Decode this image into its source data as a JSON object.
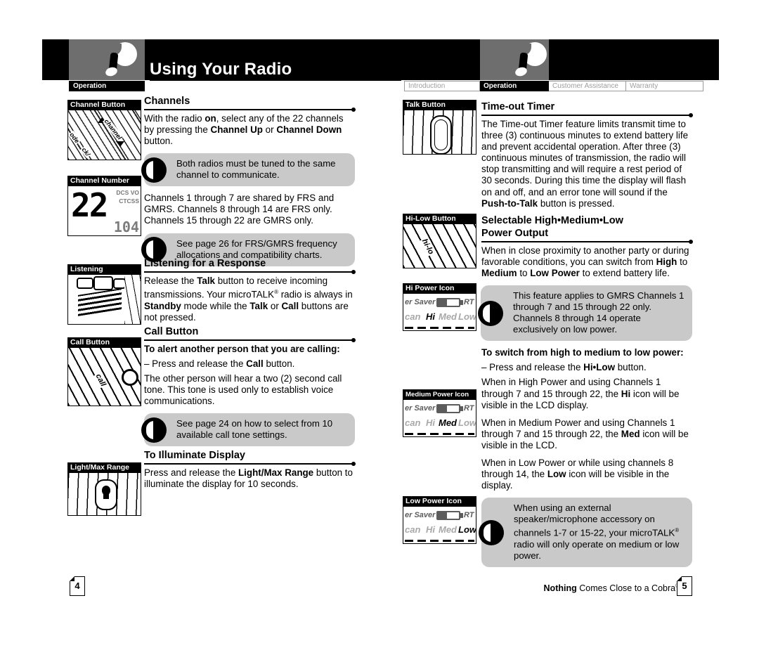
{
  "header": {
    "title": "Using Your Radio",
    "logo_icon": "cobra-radio-person-logo",
    "left_tabs": [
      {
        "label": "Operation",
        "active": true
      }
    ],
    "right_tabs": [
      {
        "label": "Introduction",
        "active": false
      },
      {
        "label": "Operation",
        "active": true
      },
      {
        "label": "Customer Assistance",
        "active": false
      },
      {
        "label": "Warranty",
        "active": false
      }
    ]
  },
  "left_page": {
    "thumbs": {
      "channel_button": {
        "caption": "Channel Button",
        "labels": {
          "mode": "ode",
          "channel": "channel",
          "lock": "ck/"
        }
      },
      "channel_number": {
        "caption": "Channel Number",
        "value": "22",
        "tag1": "DCS VO",
        "tag2": "CTCSS",
        "sub": "104"
      },
      "listening": {
        "caption": "Listening"
      },
      "call_button": {
        "caption": "Call Button",
        "label": "call"
      },
      "light_max_range": {
        "caption": "Light/Max Range",
        "icon": "light-bulb-icon"
      }
    },
    "sections": [
      {
        "id": "channels",
        "heading": "Channels",
        "p1_a": "With the radio ",
        "p1_b": "on",
        "p1_c": ", select any of the 22 channels by pressing the ",
        "p1_d": "Channel Up",
        "p1_e": " or ",
        "p1_f": "Channel Down",
        "p1_g": " button.",
        "note1": "Both radios must be tuned to the same channel to communicate.",
        "p2": "Channels 1 through 7 are shared by FRS and GMRS. Channels 8 through 14 are FRS only. Channels 15 through 22 are GMRS only.",
        "note2": "See page 26 for FRS/GMRS frequency allocations and compatibility charts."
      },
      {
        "id": "listening",
        "heading": "Listening for a Response",
        "p1_a": "Release the ",
        "p1_b": "Talk",
        "p1_c": " button to receive incoming transmissions. Your microTALK",
        "p1_sup": "®",
        "p1_d": " radio is always in ",
        "p1_e": "Standby",
        "p1_f": " mode while the ",
        "p1_g": "Talk",
        "p1_h": " or ",
        "p1_i": "Call",
        "p1_j": " buttons are not pressed."
      },
      {
        "id": "call-button",
        "heading": "Call Button",
        "subhead": "To alert another person that you are calling:",
        "bullet_a": "– Press and release the ",
        "bullet_b": "Call",
        "bullet_c": " button.",
        "p1": "The other person will hear a two (2) second call tone. This tone is used only to establish voice communications.",
        "note1": "See page 24 on how to select from 10 available call tone settings."
      },
      {
        "id": "illuminate",
        "heading": "To Illuminate Display",
        "p1_a": "Press and release the ",
        "p1_b": "Light/Max Range",
        "p1_c": " button to illuminate the display for 10 seconds."
      }
    ]
  },
  "right_page": {
    "thumbs": {
      "talk_button": {
        "caption": "Talk Button"
      },
      "hi_low_button": {
        "caption": "Hi-Low Button",
        "label": "hi-lo"
      },
      "hi_power": {
        "caption": "Hi Power Icon",
        "saver": "er Saver",
        "rt": "RT",
        "scan": "can",
        "o1": "Hi",
        "o2": "Med",
        "o3": "Low",
        "active": "Hi"
      },
      "medium_power": {
        "caption": "Medium Power Icon",
        "saver": "er Saver",
        "rt": "RT",
        "scan": "can",
        "o1": "Hi",
        "o2": "Med",
        "o3": "Low",
        "active": "Med"
      },
      "low_power": {
        "caption": "Low Power Icon",
        "saver": "er Saver",
        "rt": "RT",
        "scan": "can",
        "o1": "Hi",
        "o2": "Med",
        "o3": "Low",
        "active": "Low"
      }
    },
    "sections": [
      {
        "id": "time-out-timer",
        "heading": "Time-out Timer",
        "p1_a": "The Time-out Timer feature limits transmit time to three (3) continuous minutes to extend battery life and prevent accidental operation. After three (3) continuous minutes of transmission, the radio will stop transmitting and will require a rest period of 30 seconds. During this time the display will flash on and off, and an error tone will sound if the ",
        "p1_b": "Push-to-Talk",
        "p1_c": " button is pressed."
      },
      {
        "id": "power-output",
        "heading_l1": "Selectable High•Medium•Low",
        "heading_l2": "Power Output",
        "p1_a": "When in close proximity to another party or during favorable conditions, you can switch from ",
        "p1_b": "High",
        "p1_c": " to ",
        "p1_d": "Medium",
        "p1_e": " to ",
        "p1_f": "Low Power",
        "p1_g": " to extend battery life.",
        "note1": "This feature applies to GMRS Channels 1 through 7 and 15 through 22 only. Channels 8 through 14 operate exclusively on low power.",
        "subhead": "To switch from high to medium to low power:",
        "bullet_a": "– Press and release the ",
        "bullet_b": "Hi•Low",
        "bullet_c": " button.",
        "p2_a": "When in High Power and using Channels 1 through 7 and 15 through 22, the ",
        "p2_b": "Hi",
        "p2_c": " icon will be visible in the LCD display.",
        "p3_a": "When in Medium Power and using Channels 1 through 7 and 15 through 22, the ",
        "p3_b": "Med",
        "p3_c": " icon will be visible in the LCD.",
        "p4_a": "When in Low Power or while using channels 8 through 14, the ",
        "p4_b": "Low",
        "p4_c": " icon will be visible in the display.",
        "note2_a": "When using an external speaker/microphone accessory on channels 1-7 or 15-22, your microTALK",
        "note2_sup": "®",
        "note2_b": " radio will only operate on medium or low power."
      }
    ]
  },
  "footer": {
    "tagline_bold": "Nothing",
    "tagline_rest": " Comes Close to a Cobra",
    "tagline_sup": "®",
    "page_left": "4",
    "page_right": "5"
  }
}
